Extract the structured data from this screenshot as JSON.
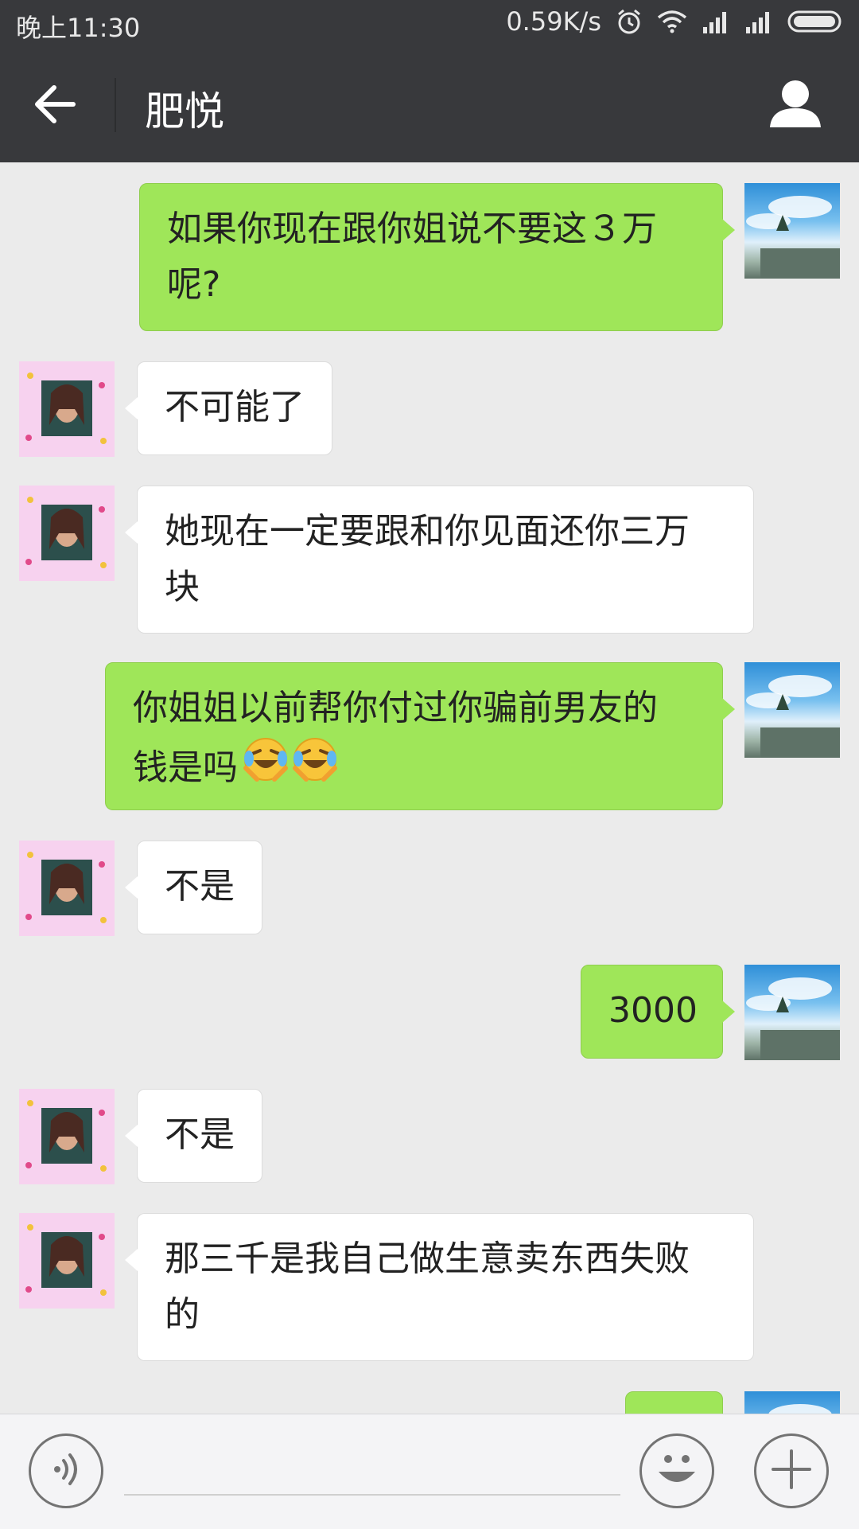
{
  "status_bar": {
    "time": "晚上11:30",
    "network_speed": "0.59K/s",
    "icons": [
      "alarm-icon",
      "wifi-icon",
      "signal-icon",
      "signal-icon",
      "battery-icon"
    ]
  },
  "header": {
    "title": "肥悦",
    "back_icon": "arrow-left-icon",
    "profile_icon": "person-icon"
  },
  "messages": [
    {
      "sender": "me",
      "lines": [
        "如果你现在跟你姐说不要这３万",
        "呢?"
      ]
    },
    {
      "sender": "friend",
      "lines": [
        "不可能了"
      ]
    },
    {
      "sender": "friend",
      "lines": [
        "她现在一定要跟和你见面还你三万",
        "块"
      ]
    },
    {
      "sender": "me",
      "lines": [
        "你姐姐以前帮你付过你骗前男友的",
        "钱是吗"
      ],
      "emoji": [
        "face-with-tears-of-joy",
        "face-with-tears-of-joy"
      ]
    },
    {
      "sender": "friend",
      "lines": [
        "不是"
      ]
    },
    {
      "sender": "me",
      "lines": [
        "3000"
      ]
    },
    {
      "sender": "friend",
      "lines": [
        "不是"
      ]
    },
    {
      "sender": "friend",
      "lines": [
        "那三千是我自己做生意卖东西失败",
        "的"
      ]
    },
    {
      "sender": "me",
      "lines": [
        ""
      ]
    }
  ],
  "input_bar": {
    "voice_icon": "voice-icon",
    "emoji_icon": "smiley-icon",
    "more_icon": "plus-icon",
    "input_value": ""
  },
  "colors": {
    "header_bg": "#38393c",
    "chat_bg": "#ebebeb",
    "my_bubble": "#9fe659",
    "friend_bubble": "#ffffff"
  }
}
